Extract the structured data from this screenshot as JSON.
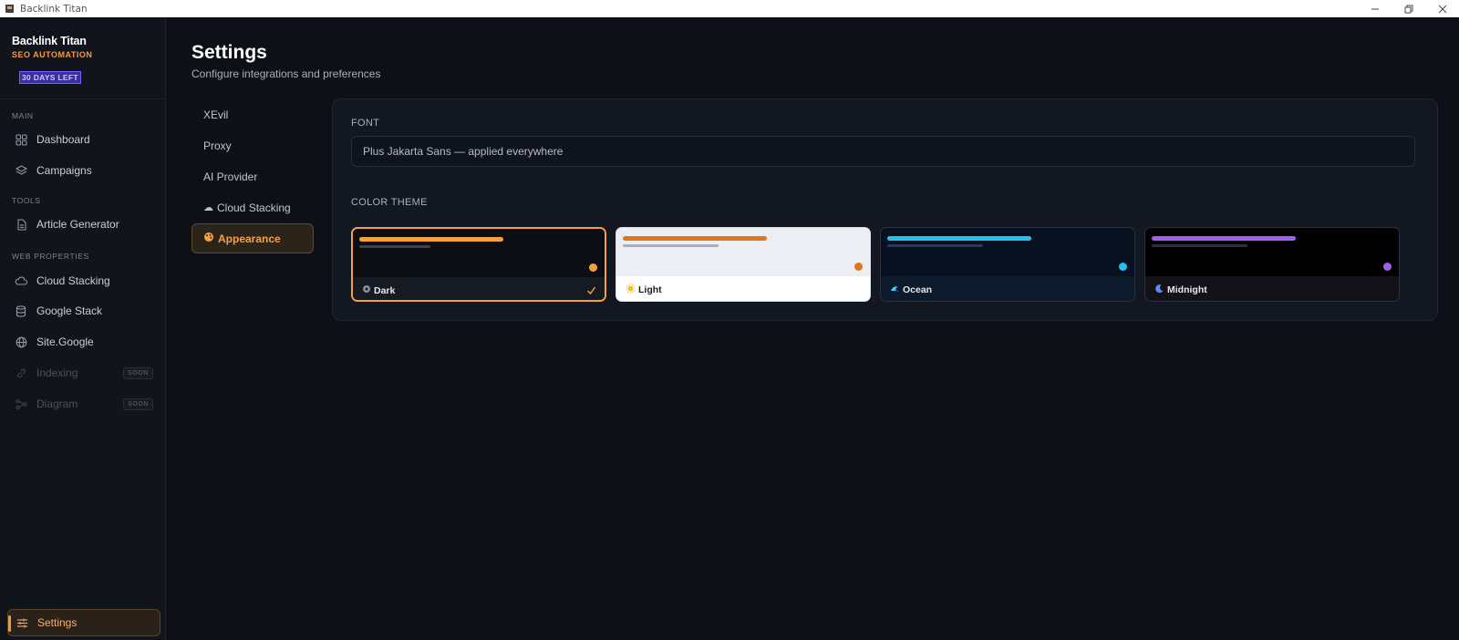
{
  "window": {
    "title": "Backlink Titan"
  },
  "sidebar": {
    "brand_name": "Backlink Titan",
    "brand_sub": "SEO AUTOMATION",
    "trial": "30 DAYS LEFT",
    "sections": {
      "main": "MAIN",
      "tools": "TOOLS",
      "web": "WEB PROPERTIES"
    },
    "items": {
      "dashboard": "Dashboard",
      "campaigns": "Campaigns",
      "article_generator": "Article Generator",
      "cloud_stacking": "Cloud Stacking",
      "google_stack": "Google Stack",
      "site_google": "Site.Google",
      "indexing": "Indexing",
      "diagram": "Diagram",
      "settings": "Settings"
    },
    "soon": "SOON"
  },
  "page": {
    "title": "Settings",
    "subtitle": "Configure integrations and preferences"
  },
  "subnav": {
    "xevil": "XEvil",
    "proxy": "Proxy",
    "ai_provider": "AI Provider",
    "cloud_stacking": "Cloud Stacking",
    "appearance": "Appearance"
  },
  "appearance": {
    "font_label": "FONT",
    "font_value": "Plus Jakarta Sans — applied everywhere",
    "theme_label": "COLOR THEME",
    "themes": [
      {
        "name": "Dark",
        "accent": "#f5a23c",
        "selected": true
      },
      {
        "name": "Light",
        "accent": "#e0761a",
        "selected": false
      },
      {
        "name": "Ocean",
        "accent": "#22c1ee",
        "selected": false
      },
      {
        "name": "Midnight",
        "accent": "#a25ef0",
        "selected": false
      }
    ]
  },
  "colors": {
    "accent": "#f59a3a",
    "background": "#0d1016",
    "sidebar": "#11141b",
    "trial_badge": "#3a2fa0"
  }
}
